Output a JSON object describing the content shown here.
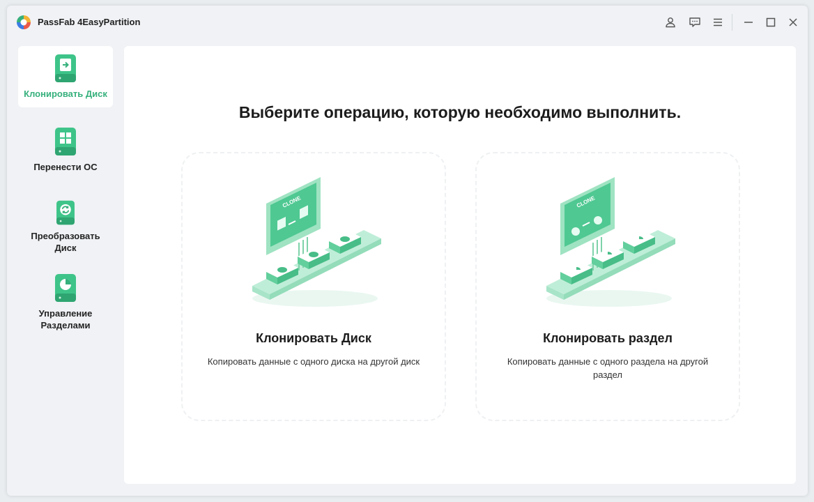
{
  "app": {
    "title": "PassFab 4EasyPartition",
    "brand_green": "#36b07c"
  },
  "window_controls": [
    "user-icon",
    "feedback-icon",
    "menu-icon",
    "minimize-icon",
    "maximize-icon",
    "close-icon"
  ],
  "sidebar": {
    "items": [
      {
        "label": "Клонировать Диск",
        "icon": "clone-disk-icon",
        "active": true
      },
      {
        "label": "Перенести ОС",
        "icon": "windows-icon",
        "active": false
      },
      {
        "label": "Преобразовать Диск",
        "icon": "convert-icon",
        "active": false
      },
      {
        "label": "Управление Разделами",
        "icon": "pie-chart-icon",
        "active": false
      }
    ]
  },
  "main": {
    "heading": "Выберите операцию, которую необходимо выполнить.",
    "cards": [
      {
        "title": "Клонировать Диск",
        "description": "Копировать данные с одного диска на другой диск",
        "illustration": "clone-disk-illustration",
        "monitor_text": "CLONE"
      },
      {
        "title": "Клонировать раздел",
        "description": "Копировать данные с одного раздела на другой раздел",
        "illustration": "clone-partition-illustration",
        "monitor_text": "CLONE"
      }
    ]
  }
}
